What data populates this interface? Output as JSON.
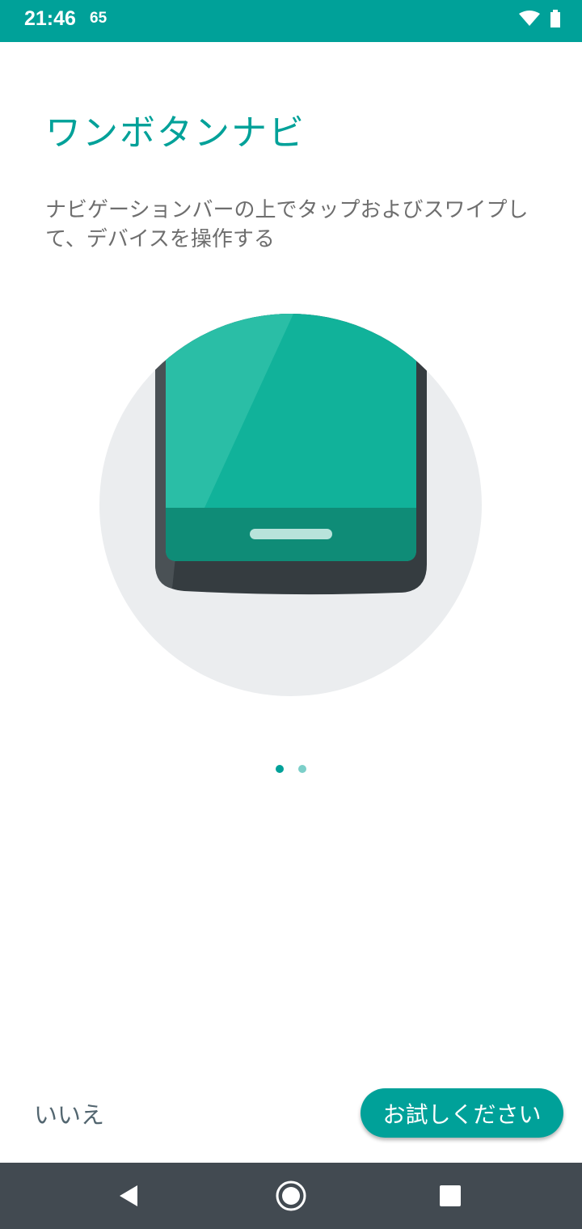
{
  "status_bar": {
    "time": "21:46",
    "notification": "65"
  },
  "page": {
    "title": "ワンボタンナビ",
    "description": "ナビゲーションバーの上でタップおよびスワイプして、デバイスを操作する"
  },
  "pager": {
    "total": 2,
    "current": 1
  },
  "actions": {
    "no_label": "いいえ",
    "try_label": "お試しください"
  },
  "nav_bar": {
    "back_icon": "back-triangle-icon",
    "home_icon": "home-circle-icon",
    "recents_icon": "recents-square-icon"
  },
  "colors": {
    "accent": "#00a199",
    "circle_bg": "#ebedef",
    "screen": "#11b29a",
    "nav_bar": "#424a51"
  }
}
